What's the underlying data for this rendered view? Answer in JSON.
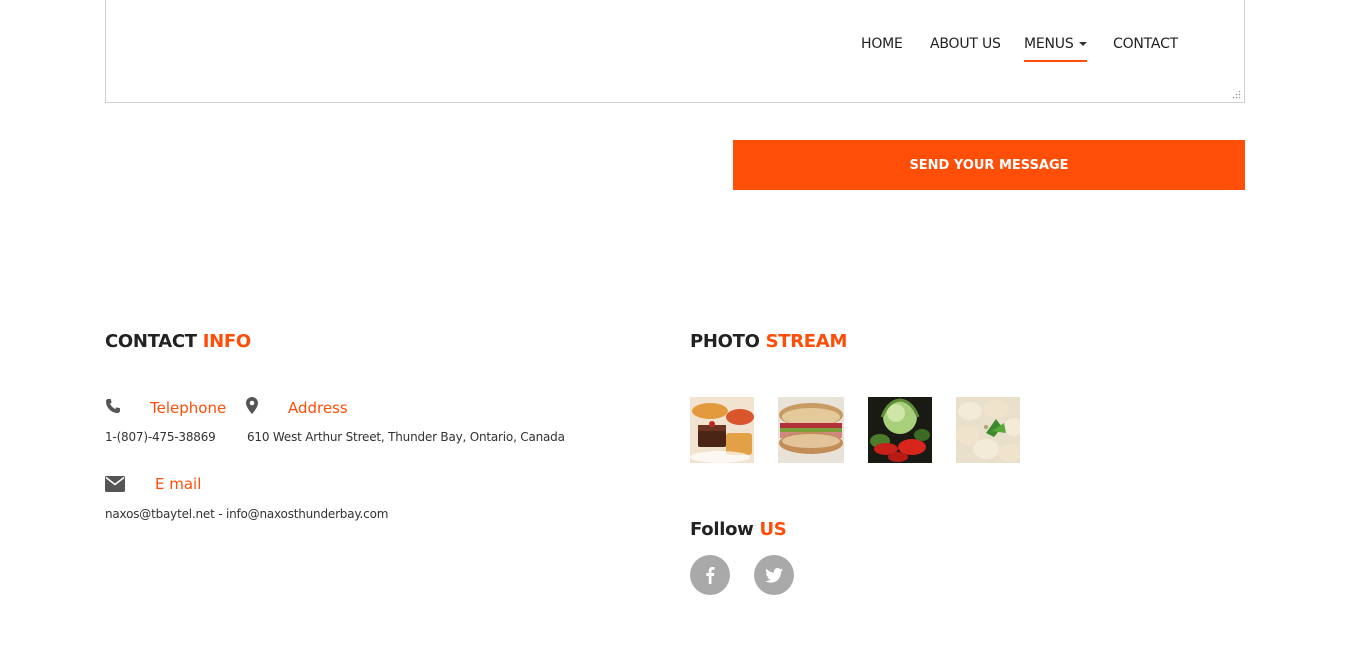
{
  "nav": {
    "items": [
      {
        "label": "HOME"
      },
      {
        "label": "ABOUT US"
      },
      {
        "label": "MENUS",
        "active": true,
        "has_dropdown": true
      },
      {
        "label": "CONTACT"
      }
    ]
  },
  "form": {
    "send_label": "SEND YOUR MESSAGE"
  },
  "contact_info": {
    "heading_main": "CONTACT",
    "heading_accent": "INFO",
    "telephone_label": "Telephone",
    "telephone_value": "1-(807)-475-38869",
    "address_label": "Address",
    "address_value": "610 West Arthur Street, Thunder Bay, Ontario, Canada",
    "email_label": "E mail",
    "email_value": "naxos@tbaytel.net - info@naxosthunderbay.com"
  },
  "photo_stream": {
    "heading_main": "PHOTO",
    "heading_accent": "STREAM",
    "photos": [
      "dessert-photo",
      "sandwich-photo",
      "vegetables-photo",
      "dumplings-photo"
    ]
  },
  "follow": {
    "heading_main": "Follow",
    "heading_accent": "US",
    "icons": [
      "facebook-icon",
      "twitter-icon"
    ]
  },
  "colors": {
    "accent": "#ff4e08",
    "icon_gray": "#a9a9a9",
    "text_dark": "#222222"
  }
}
